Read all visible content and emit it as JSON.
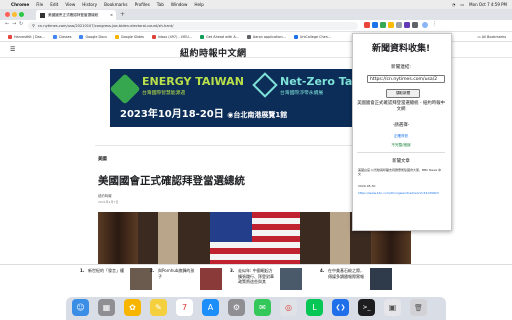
{
  "menubar": {
    "apple_glyph": "",
    "app_name": "Chrome",
    "items": [
      "File",
      "Edit",
      "View",
      "History",
      "Bookmarks",
      "Profiles",
      "Tab",
      "Window",
      "Help"
    ],
    "clock": "Mon Oct 7 4:59 PM"
  },
  "browser": {
    "tab_title": "美國國會正式確認拜登當選總統",
    "tab_close": "×",
    "new_tab": "+",
    "nav": {
      "back": "←",
      "forward": "→",
      "reload": "↻"
    },
    "url": "cn.nytimes.com/usa/20210107/congress-joe-biden-electoral-count/zh-hant/"
  },
  "bookmarks": {
    "items": [
      {
        "label": "HarvestKit | Das...",
        "color": "#e8453c"
      },
      {
        "label": "Classes",
        "color": "#4285f4"
      },
      {
        "label": "Google Docs",
        "color": "#4285f4"
      },
      {
        "label": "Google Slides",
        "color": "#f4b400"
      },
      {
        "label": "Inbox (497) - LYEU...",
        "color": "#db4437"
      },
      {
        "label": "Get Ahead with A...",
        "color": "#0f9d58"
      },
      {
        "label": "Aaron application...",
        "color": "#5f6368"
      },
      {
        "label": "UniCollege Chen...",
        "color": "#1a73e8"
      }
    ],
    "all_label": "All Bookmarks"
  },
  "site": {
    "menu_icon": "☰",
    "logo": "紐約時報中文網"
  },
  "ad": {
    "title1": "ENERGY TAIWAN",
    "subtitle1": "台灣國際智慧能源週",
    "title2": "Net-Zero Taiwa",
    "subtitle2": "台灣國際淨零永續展",
    "dates": "2023年10月18-20日",
    "venue": "台北南港展覽1館",
    "cta": "登記"
  },
  "article": {
    "section": "美國",
    "headline": "美國國會正式確認拜登當選總統",
    "byline": "紐約時報",
    "date": "2021年1月7日"
  },
  "recommendations": [
    {
      "num": "1.",
      "title": "新世紀的「發言」權"
    },
    {
      "num": "2.",
      "title": "與Pornhub旗鋒的孩子"
    },
    {
      "num": "3.",
      "title": "走似年: 中國崛起方擴張踐行、拜登對華政策將這些與其"
    },
    {
      "num": "4.",
      "title": "在中美基石較之際，傳媒多讀國報際實報"
    }
  ],
  "popup": {
    "title": "新聞資料收集!",
    "link_label": "新聞連結:",
    "url_value": "https://cn.nytimes.com/usa/2",
    "fetch_button": "擷取新聞",
    "description": "美國國會正式確認拜登當選總統 - 紐約時報中文網",
    "select_label": "-請選擇-",
    "select_opt1": "正確資訊",
    "select_opt2": "不完整/錯誤",
    "news_label": "新聞文章",
    "news_text": "美國白宮:川普動員呼籲支持群眾衝擊國會大廈，BBC News 中文",
    "news_date": "2020-05-30",
    "news_url": "https://www.bbc.com/zhongwen/trad/world-54145823"
  },
  "dock": {
    "icons": [
      {
        "name": "finder",
        "color": "#3a8ee6",
        "glyph": "☺"
      },
      {
        "name": "launchpad",
        "color": "#8e8e93",
        "glyph": "▦"
      },
      {
        "name": "photos",
        "color": "#f7b500",
        "glyph": "✿"
      },
      {
        "name": "notes",
        "color": "#f4d03f",
        "glyph": "✎"
      },
      {
        "name": "calendar",
        "color": "#ffffff",
        "glyph": "7"
      },
      {
        "name": "app-store",
        "color": "#1c8ef9",
        "glyph": "A"
      },
      {
        "name": "system-settings",
        "color": "#8e8e93",
        "glyph": "⚙"
      },
      {
        "name": "messages",
        "color": "#34c759",
        "glyph": "✉"
      },
      {
        "name": "chrome",
        "color": "#dfe3e8",
        "glyph": "◎"
      },
      {
        "name": "line",
        "color": "#06c755",
        "glyph": "L"
      },
      {
        "name": "vscode",
        "color": "#1f6feb",
        "glyph": "❮❯"
      },
      {
        "name": "terminal",
        "color": "#1d1d1f",
        "glyph": ">_"
      },
      {
        "name": "preview",
        "color": "#e5e5ea",
        "glyph": "▣"
      },
      {
        "name": "trash",
        "color": "#d1d1d6",
        "glyph": "🗑"
      }
    ]
  }
}
